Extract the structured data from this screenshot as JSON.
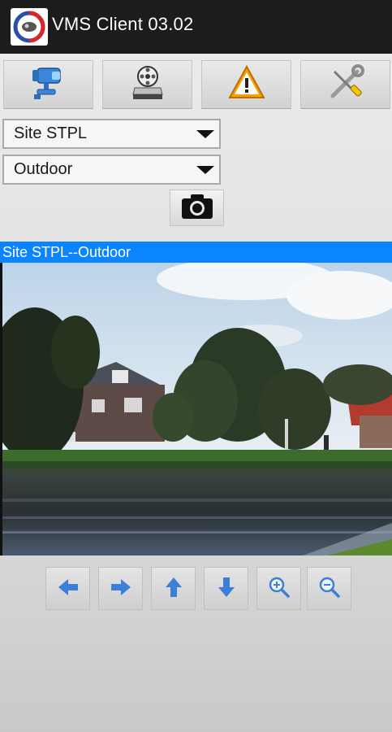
{
  "app": {
    "title": "VMS Client 03.02"
  },
  "toolbar": {
    "buttons": [
      {
        "icon": "camera-icon"
      },
      {
        "icon": "video-recorder-icon"
      },
      {
        "icon": "warning-icon"
      },
      {
        "icon": "tools-icon"
      }
    ]
  },
  "site_select": {
    "value": "Site STPL"
  },
  "camera_select": {
    "value": "Outdoor"
  },
  "snapshot": {
    "icon": "camera-icon"
  },
  "feed": {
    "title": "Site STPL--Outdoor"
  },
  "ptz_controls": [
    {
      "icon": "arrow-left-icon"
    },
    {
      "icon": "arrow-right-icon"
    },
    {
      "icon": "arrow-up-icon"
    },
    {
      "icon": "arrow-down-icon"
    },
    {
      "icon": "zoom-in-icon"
    },
    {
      "icon": "zoom-out-icon"
    }
  ],
  "colors": {
    "titlebar": "#1c1c1c",
    "feed_header": "#0a84ff",
    "control_arrow": "#3d7fd6",
    "warning": "#f5a00a"
  }
}
